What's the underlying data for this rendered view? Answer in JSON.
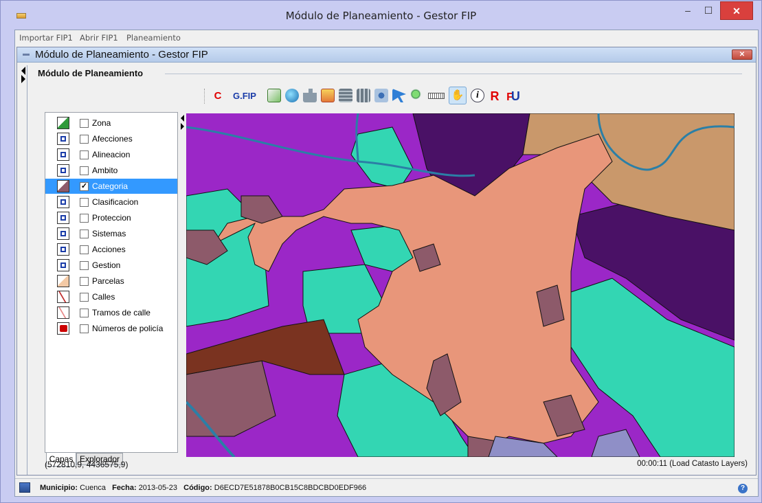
{
  "window": {
    "title": "Módulo de Planeamiento - Gestor FIP",
    "minimize_glyph": "–",
    "maximize_glyph": "☐",
    "close_glyph": "✕"
  },
  "menu": {
    "items": [
      "Importar FIP1",
      "Abrir FIP1",
      "Planeamiento"
    ]
  },
  "inner_window": {
    "title": "Módulo de Planeamiento - Gestor FIP",
    "close_glyph": "✕",
    "group_label": "Módulo de Planeamiento"
  },
  "toolbar": {
    "c_label": "C",
    "gfip_label": "G.FIP",
    "r_label": "R",
    "fu_label_f": "F",
    "fu_label_u": "U",
    "info_label": "i",
    "icons": [
      "edit-icon",
      "globe-search-icon",
      "puzzle-icon",
      "sld-style-icon",
      "table-icon",
      "layers-grid-icon",
      "network-icon",
      "pointer-icon",
      "zoom-icon",
      "ruler-icon",
      "pan-hand-icon",
      "info-icon"
    ]
  },
  "layers": {
    "items": [
      {
        "label": "Zona",
        "checked": false,
        "icon": "polygon-green-icon"
      },
      {
        "label": "Afecciones",
        "checked": false,
        "icon": "polygon-select-icon"
      },
      {
        "label": "Alineacion",
        "checked": false,
        "icon": "polygon-select-icon"
      },
      {
        "label": "Ambito",
        "checked": false,
        "icon": "polygon-select-icon"
      },
      {
        "label": "Categoria",
        "checked": true,
        "icon": "polygon-brown-icon"
      },
      {
        "label": "Clasificacion",
        "checked": false,
        "icon": "polygon-select-icon"
      },
      {
        "label": "Proteccion",
        "checked": false,
        "icon": "polygon-select-icon"
      },
      {
        "label": "Sistemas",
        "checked": false,
        "icon": "polygon-select-icon"
      },
      {
        "label": "Acciones",
        "checked": false,
        "icon": "polygon-select-icon"
      },
      {
        "label": "Gestion",
        "checked": false,
        "icon": "polygon-select-icon"
      },
      {
        "label": "Parcelas",
        "checked": false,
        "icon": "parcel-icon"
      },
      {
        "label": "Calles",
        "checked": false,
        "icon": "street-icon"
      },
      {
        "label": "Tramos de calle",
        "checked": false,
        "icon": "street-segment-icon"
      },
      {
        "label": "Números de policía",
        "checked": false,
        "icon": "house-number-icon"
      }
    ],
    "selected_index": 4
  },
  "tabs": {
    "capas": "Capas",
    "explorador": "Explorador"
  },
  "map": {
    "coords": "(572810,9, 4436575,9)",
    "load_status": "00:00:11 (Load Catasto Layers)"
  },
  "status": {
    "municipio_label": "Municipio:",
    "municipio_value": "Cuenca",
    "fecha_label": "Fecha:",
    "fecha_value": "2013-05-23",
    "codigo_label": "Código:",
    "codigo_value": "D6ECD7E51878B0CB15C8BDCBD0EDF966",
    "help_glyph": "?"
  },
  "colors": {
    "purple": "#9b27c7",
    "dark_purple": "#4a1166",
    "teal": "#33d6b3",
    "salmon": "#e8967a",
    "tan": "#c9986b",
    "mauve": "#8d5a6a",
    "brown": "#7a3320",
    "lavender": "#8f8fc7",
    "river": "#2b7fa6"
  }
}
